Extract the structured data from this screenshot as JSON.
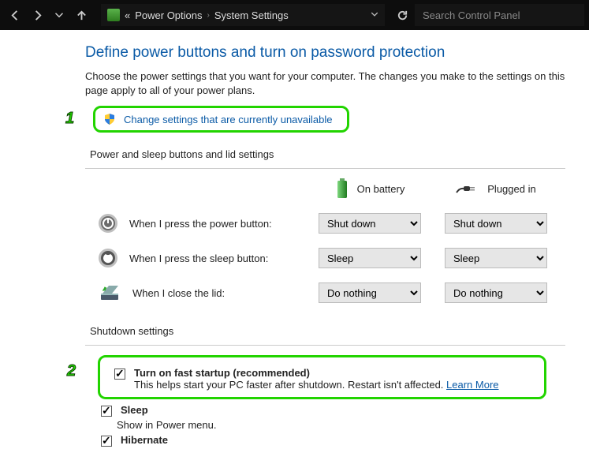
{
  "titlebar": {
    "breadcrumb_left": "«",
    "breadcrumb1": "Power Options",
    "breadcrumb2": "System Settings",
    "search_placeholder": "Search Control Panel"
  },
  "page": {
    "title": "Define power buttons and turn on password protection",
    "description": "Choose the power settings that you want for your computer. The changes you make to the settings on this page apply to all of your power plans.",
    "change_link": "Change settings that are currently unavailable"
  },
  "annotations": {
    "one": "1",
    "two": "2"
  },
  "section1": {
    "title": "Power and sleep buttons and lid settings",
    "col_battery": "On battery",
    "col_plugged": "Plugged in",
    "rows": {
      "power": {
        "label": "When I press the power button:",
        "battery": "Shut down",
        "plugged": "Shut down"
      },
      "sleep": {
        "label": "When I press the sleep button:",
        "battery": "Sleep",
        "plugged": "Sleep"
      },
      "lid": {
        "label": "When I close the lid:",
        "battery": "Do nothing",
        "plugged": "Do nothing"
      }
    }
  },
  "section2": {
    "title": "Shutdown settings",
    "fast": {
      "label": "Turn on fast startup (recommended)",
      "sub": "This helps start your PC faster after shutdown. Restart isn't affected. ",
      "learn": "Learn More"
    },
    "sleep": {
      "label": "Sleep",
      "sub": "Show in Power menu."
    },
    "hibernate": {
      "label": "Hibernate"
    }
  }
}
